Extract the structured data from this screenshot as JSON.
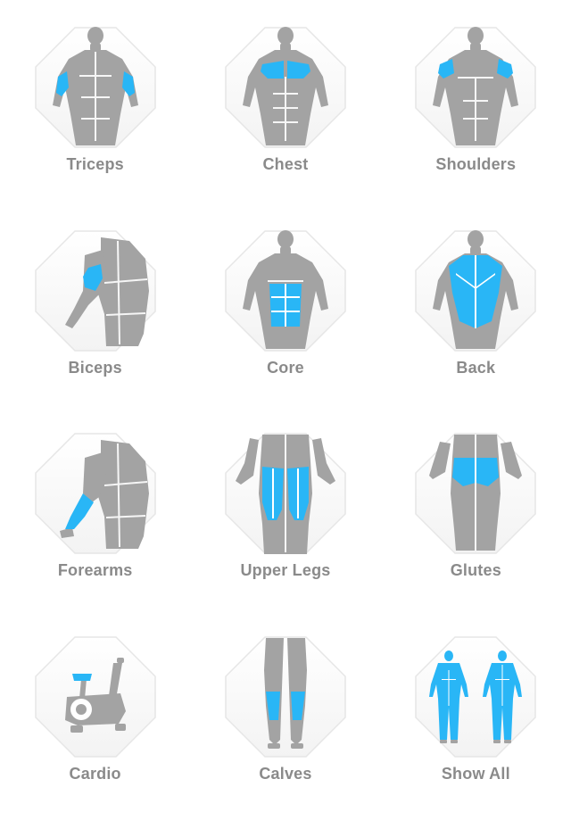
{
  "colors": {
    "muscle_gray": "#a3a3a3",
    "highlight_blue": "#29b6f6",
    "label_gray": "#8a8a8a",
    "badge_stroke": "#e6e6e6"
  },
  "categories": [
    {
      "label": "Triceps",
      "icon": "back-body-triceps-icon"
    },
    {
      "label": "Chest",
      "icon": "front-body-chest-icon"
    },
    {
      "label": "Shoulders",
      "icon": "front-body-shoulders-icon"
    },
    {
      "label": "Biceps",
      "icon": "side-body-biceps-icon"
    },
    {
      "label": "Core",
      "icon": "front-body-core-icon"
    },
    {
      "label": "Back",
      "icon": "back-body-back-icon"
    },
    {
      "label": "Forearms",
      "icon": "side-body-forearms-icon"
    },
    {
      "label": "Upper Legs",
      "icon": "legs-upper-legs-icon"
    },
    {
      "label": "Glutes",
      "icon": "back-lower-glutes-icon"
    },
    {
      "label": "Cardio",
      "icon": "exercise-bike-icon"
    },
    {
      "label": "Calves",
      "icon": "legs-calves-icon"
    },
    {
      "label": "Show All",
      "icon": "full-body-all-muscles-icon"
    }
  ]
}
